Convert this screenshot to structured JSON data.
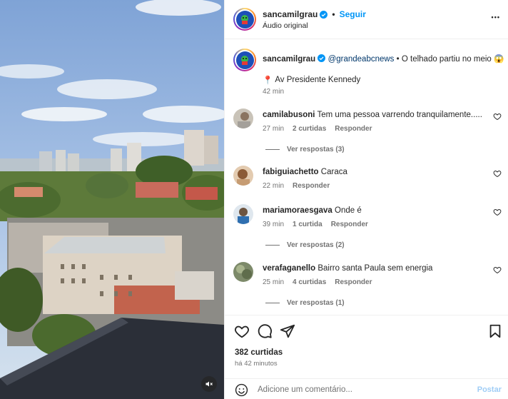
{
  "post": {
    "username": "sancamilgrau",
    "follow_label": "Seguir",
    "dot": "•",
    "audio": "Áudio original",
    "more_label": "•••"
  },
  "caption": {
    "username": "sancamilgrau",
    "mention": "@grandeabcnews",
    "text": "• O telhado partiu no meio 😱",
    "location_pin": "📍",
    "location": "Av Presidente Kennedy",
    "time": "42 min"
  },
  "comments": [
    {
      "username": "camilabusoni",
      "text": "Tem uma pessoa varrendo tranquilamente.....",
      "time": "27 min",
      "likes": "2 curtidas",
      "reply": "Responder",
      "view_replies": "Ver respostas (3)"
    },
    {
      "username": "fabiguiachetto",
      "text": "Caraca",
      "time": "22 min",
      "likes": "",
      "reply": "Responder",
      "view_replies": ""
    },
    {
      "username": "mariamoraesgava",
      "text": "Onde é",
      "time": "39 min",
      "likes": "1 curtida",
      "reply": "Responder",
      "view_replies": "Ver respostas (2)"
    },
    {
      "username": "verafaganello",
      "text": "Bairro santa Paula sem energia",
      "time": "25 min",
      "likes": "4 curtidas",
      "reply": "Responder",
      "view_replies": "Ver respostas (1)"
    }
  ],
  "stats": {
    "likes": "382 curtidas",
    "posted": "há 42 minutos"
  },
  "add_comment": {
    "placeholder": "Adicione um comentário...",
    "post_label": "Postar"
  },
  "colors": {
    "accent": "#0095f6",
    "post_disabled": "#9fcdf6",
    "muted_text": "#737373",
    "mention": "#00376b"
  }
}
